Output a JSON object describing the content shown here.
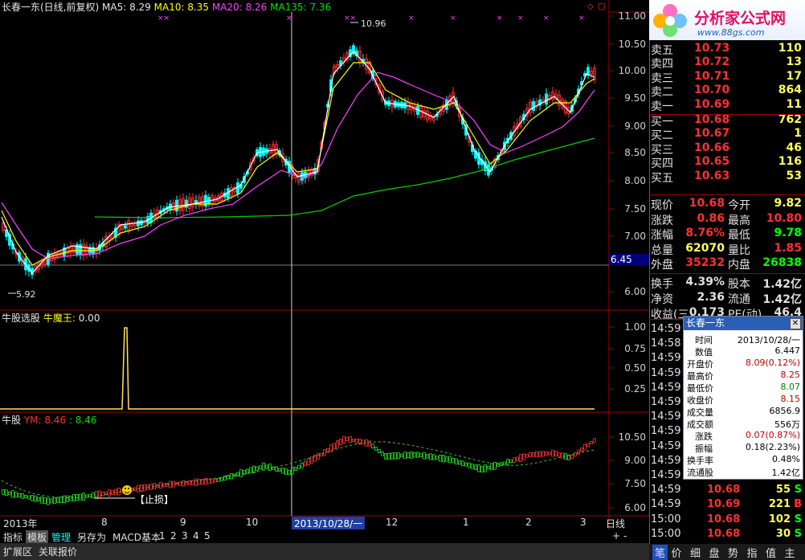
{
  "main_header": {
    "title": "长春一东(日线,前复权)",
    "ma5": "MA5: 8.29",
    "ma10": "MA10: 8.35",
    "ma20": "MA20: 8.26",
    "ma135": "MA135: 7.36"
  },
  "main_axis": [
    "11.00",
    "10.50",
    "10.00",
    "9.50",
    "9.00",
    "8.50",
    "8.00",
    "7.50",
    "7.00",
    "6.50",
    "6.00"
  ],
  "price_marker": "6.45",
  "high_label": "10.96",
  "low_label": "5.92",
  "ind1_header": {
    "name": "牛股选股",
    "series": "牛魔王",
    "value": "0.00"
  },
  "ind1_axis": [
    "1.00",
    "0.75",
    "0.50",
    "0.25"
  ],
  "ind2_header": {
    "name": "牛股",
    "ym": "YM: 8.46",
    "v": ": 8.46"
  },
  "ind2_axis": [
    "10.50",
    "9.00",
    "7.50",
    "6.00"
  ],
  "stop_label": "【止损】",
  "date_axis": {
    "year": "2013年",
    "m8": "8",
    "m9": "9",
    "m10": "10",
    "cursor": "2013/10/28/一",
    "m12": "12",
    "m1": "1",
    "m2": "2",
    "m3": "3"
  },
  "toolbar": {
    "t1": "指标",
    "t2": "模板",
    "t3": "管理",
    "t4": "另存为",
    "t5": "MACD基本",
    "n1": "1",
    "n2": "2",
    "n3": "3",
    "n4": "4",
    "n5": "5",
    "plus": "+",
    "minus": "-",
    "period": "日线"
  },
  "bottombar": {
    "b1": "扩展区",
    "b2": "关联报价"
  },
  "logo": {
    "name": "分析家公式网",
    "url": "www.88gs.com"
  },
  "orderbook": [
    {
      "label": "卖五",
      "price": "10.73",
      "vol": "110"
    },
    {
      "label": "卖四",
      "price": "10.72",
      "vol": "13"
    },
    {
      "label": "卖三",
      "price": "10.71",
      "vol": "17"
    },
    {
      "label": "卖二",
      "price": "10.70",
      "vol": "864"
    },
    {
      "label": "卖一",
      "price": "10.69",
      "vol": "11"
    },
    {
      "label": "买一",
      "price": "10.68",
      "vol": "762"
    },
    {
      "label": "买二",
      "price": "10.67",
      "vol": "1"
    },
    {
      "label": "买三",
      "price": "10.66",
      "vol": "46"
    },
    {
      "label": "买四",
      "price": "10.65",
      "vol": "116"
    },
    {
      "label": "买五",
      "price": "10.63",
      "vol": "53"
    }
  ],
  "stats": [
    {
      "k1": "现价",
      "v1": "10.68",
      "k2": "今开",
      "v2": "9.82"
    },
    {
      "k1": "涨跌",
      "v1": "0.86",
      "k2": "最高",
      "v2": "10.80"
    },
    {
      "k1": "涨幅",
      "v1": "8.76%",
      "k2": "最低",
      "v2": "9.78"
    },
    {
      "k1": "总量",
      "v1": "62070",
      "k2": "量比",
      "v2": "1.85"
    },
    {
      "k1": "外盘",
      "v1": "35232",
      "k2": "内盘",
      "v2": "26838"
    }
  ],
  "stats2": [
    {
      "k1": "换手",
      "v1": "4.39%",
      "k2": "股本",
      "v2": "1.42亿"
    },
    {
      "k1": "净资",
      "v1": "2.36",
      "k2": "流通",
      "v2": "1.42亿"
    },
    {
      "k1": "收益(三)",
      "v1": "0.173",
      "k2": "PE(动)",
      "v2": "46.4"
    }
  ],
  "trades": [
    {
      "t": "14:59"
    },
    {
      "t": "14:58"
    },
    {
      "t": "14:59"
    },
    {
      "t": "14:59"
    },
    {
      "t": "14:59"
    },
    {
      "t": "14:59"
    },
    {
      "t": "14:59"
    },
    {
      "t": "14:59"
    },
    {
      "t": "14:59"
    },
    {
      "t": "14:59"
    },
    {
      "t": "14:59"
    },
    {
      "t": "14:59",
      "p": "10.68",
      "v": "55",
      "s": "S"
    },
    {
      "t": "14:59",
      "p": "10.69",
      "v": "221",
      "s": "B"
    },
    {
      "t": "15:00",
      "p": "10.68",
      "v": "102",
      "s": "S"
    },
    {
      "t": "15:00",
      "p": "10.68",
      "v": "30",
      "s": "S"
    }
  ],
  "rtabs": [
    "笔",
    "价",
    "细",
    "盘",
    "势",
    "指",
    "值",
    "主"
  ],
  "popup": {
    "title": "长春一东",
    "rows": [
      {
        "k": "时间",
        "v": "2013/10/28/一"
      },
      {
        "k": "数值",
        "v": "6.447"
      },
      {
        "k": "开盘价",
        "v": "8.09(0.12%)"
      },
      {
        "k": "最高价",
        "v": "8.25"
      },
      {
        "k": "最低价",
        "v": "8.07"
      },
      {
        "k": "收盘价",
        "v": "8.15"
      },
      {
        "k": "成交量",
        "v": "6856.9"
      },
      {
        "k": "成交额",
        "v": "556万"
      },
      {
        "k": "涨跌",
        "v": "0.07(0.87%)"
      },
      {
        "k": "振幅",
        "v": "0.18(2.23%)"
      },
      {
        "k": "换手率",
        "v": "0.48%"
      },
      {
        "k": "流通股",
        "v": "1.42亿"
      }
    ]
  },
  "colors": {
    "up": "#ff3030",
    "down": "#00ffff",
    "ma5": "#ffffff",
    "ma10": "#ffff00",
    "ma20": "#ff40ff",
    "ma135": "#00e000"
  }
}
